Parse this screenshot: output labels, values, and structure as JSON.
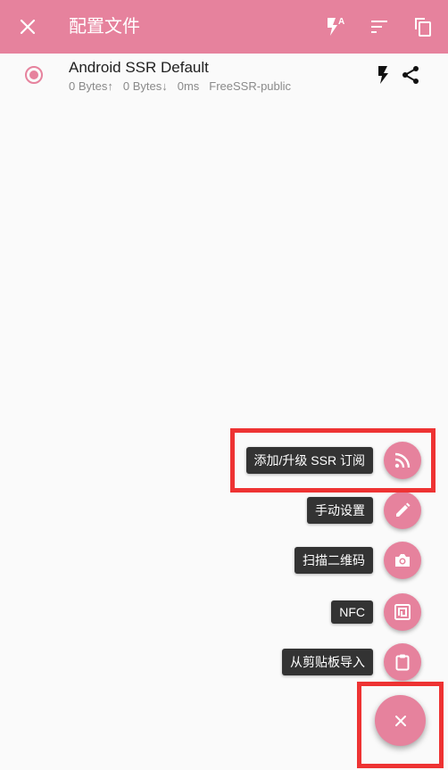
{
  "toolbar": {
    "title": "配置文件",
    "color": "#e6829d",
    "icons": [
      "close-icon",
      "flash-auto-icon",
      "sort-icon",
      "copy-icon"
    ]
  },
  "profile": {
    "name": "Android SSR Default",
    "tx": "0 Bytes↑",
    "rx": "0 Bytes↓",
    "latency": "0ms",
    "group": "FreeSSR-public",
    "selected": true
  },
  "fab_menu": {
    "items": [
      {
        "label": "添加/升级 SSR 订阅",
        "icon": "rss-icon"
      },
      {
        "label": "手动设置",
        "icon": "pencil-icon"
      },
      {
        "label": "扫描二维码",
        "icon": "camera-icon"
      },
      {
        "label": "NFC",
        "icon": "nfc-icon"
      },
      {
        "label": "从剪贴板导入",
        "icon": "clipboard-icon"
      }
    ],
    "close_icon": "close-icon"
  },
  "highlight_color": "#ee3333"
}
